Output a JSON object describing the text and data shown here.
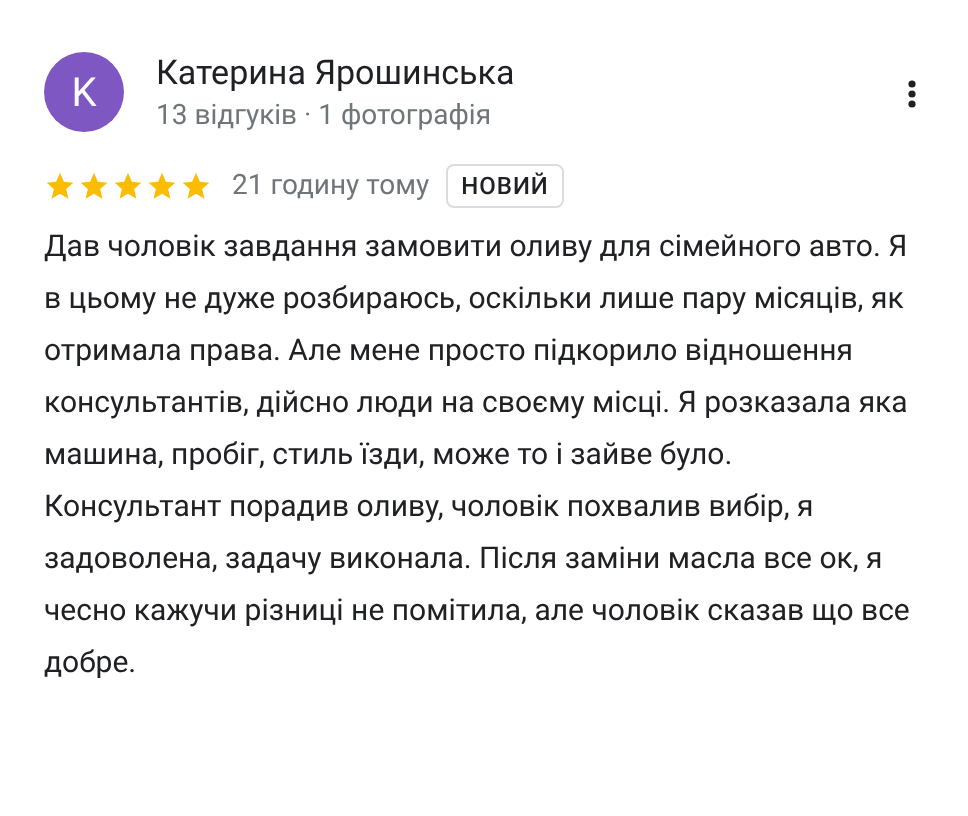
{
  "review": {
    "avatar_letter": "K",
    "author": "Катерина Ярошинська",
    "author_meta": "13 відгуків · 1 фотографія",
    "stars": 5,
    "time": "21 годину тому",
    "badge": "НОВИЙ",
    "text": "Дав чоловік завдання замовити оливу для сімейного авто. Я в цьому не дуже розбираюсь, оскільки лише пару місяців, як отримала права. Але мене просто підкорило відношення консультантів, дійсно люди на своєму місці. Я розказала яка машина, пробіг, стиль їзди, може то і зайве було. Консультант порадив оливу, чоловік похвалив вибір, я задоволена, задачу виконала. Після заміни масла все ок, я чесно кажучи різниці не помітила, але чоловік сказав що все добре."
  }
}
